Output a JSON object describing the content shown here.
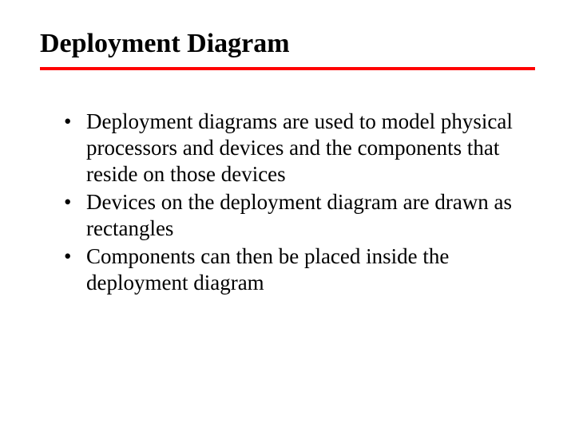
{
  "slide": {
    "title": "Deployment Diagram",
    "bullets": [
      "Deployment diagrams are used to model physical processors and devices and the components that reside on those devices",
      "Devices on the deployment diagram are drawn as rectangles",
      "Components can then be placed inside the deployment diagram"
    ]
  }
}
